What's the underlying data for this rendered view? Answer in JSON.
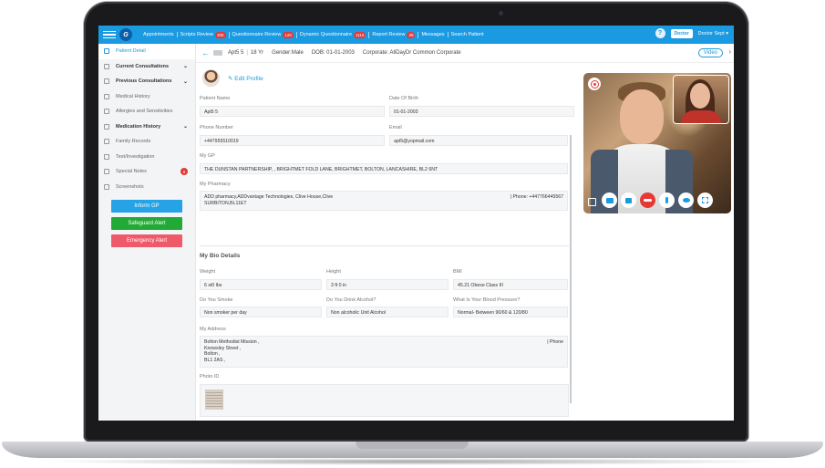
{
  "topbar": {
    "logo": "G",
    "nav": [
      {
        "label": "Appointments",
        "badge": ""
      },
      {
        "label": "Scripts Review",
        "badge": "305"
      },
      {
        "label": "Questionnaire Review",
        "badge": "120"
      },
      {
        "label": "Dynamic Questionnaire",
        "badge": "1110"
      },
      {
        "label": "Report Review",
        "badge": "38"
      },
      {
        "label": "Messages",
        "badge": ""
      },
      {
        "label": "Search Patient",
        "badge": ""
      }
    ],
    "role": "Doctor",
    "user": "Doctor Sept ▾"
  },
  "sidebar": {
    "items": [
      {
        "label": "Patient Detail"
      },
      {
        "label": "Current Consultations"
      },
      {
        "label": "Previous Consultations"
      },
      {
        "label": "Medical History"
      },
      {
        "label": "Allergies and Sensitivities"
      },
      {
        "label": "Medication History"
      },
      {
        "label": "Family Records"
      },
      {
        "label": "Test/Investigation"
      },
      {
        "label": "Special Notes",
        "badge": "6"
      },
      {
        "label": "Screenshots"
      }
    ],
    "buttons": {
      "inform": "Inform GP",
      "safeguard": "Safeguard Alert",
      "emergency": "Emergency Alert"
    }
  },
  "header": {
    "name": "Apt5 5",
    "age": "18 Yr",
    "gender": "Gender:Male",
    "dob": "DOB: 01-01-2003",
    "corporate": "Corporate: AllDayDr Common Corporate",
    "video": "Video"
  },
  "detail": {
    "edit_profile": "✎ Edit Profile",
    "patient_name_label": "Patient Name",
    "patient_name": "Apt5 5",
    "dob_label": "Date Of Birth",
    "dob": "01-01-2003",
    "phone_label": "Phone Number",
    "phone": "+447955510019",
    "email_label": "Email",
    "email": "apt5@yopmail.com",
    "gp_label": "My GP",
    "gp": "THE DUNSTAN PARTNERSHIP, , BRIGHTMET FOLD LANE, BRIGHTMET, BOLTON, LANCASHIRE, BL2 6NT",
    "pharmacy_label": "My Pharmacy",
    "pharmacy": "ADD pharmacy,ADDvantage Technologies, Clive House,Clive SURBITON,BL11ET",
    "pharmacy_phone": "| Phone: +447766445567",
    "bio_title": "My Bio Details",
    "weight_label": "Weight",
    "weight": "6 st0 lbs",
    "height_label": "Height",
    "height": "3 ft 0 in",
    "bmi_label": "BMI",
    "bmi": "45.21 Obese Class III",
    "smoke_label": "Do You Smoke",
    "smoke": "Non smoker per day",
    "alcohol_label": "Do You Drink Alcohol?",
    "alcohol": "Non alcoholic Unit Alcohol",
    "bp_label": "What Is Your Blood Pressure?",
    "bp": "Normal- Between 90/60 & 120/80",
    "address_label": "My Address",
    "address_lines": [
      "Bolton Methodist Mission ,",
      "Knowsley Street ,",
      "Bolton ,",
      "BL1 2AS ,"
    ],
    "address_phone": "| Phone",
    "photo_label": "Photo ID"
  },
  "colors": {
    "primary": "#1a9ae0",
    "green": "#22aa36",
    "red": "#ef5a6a",
    "badge": "#e53935"
  }
}
